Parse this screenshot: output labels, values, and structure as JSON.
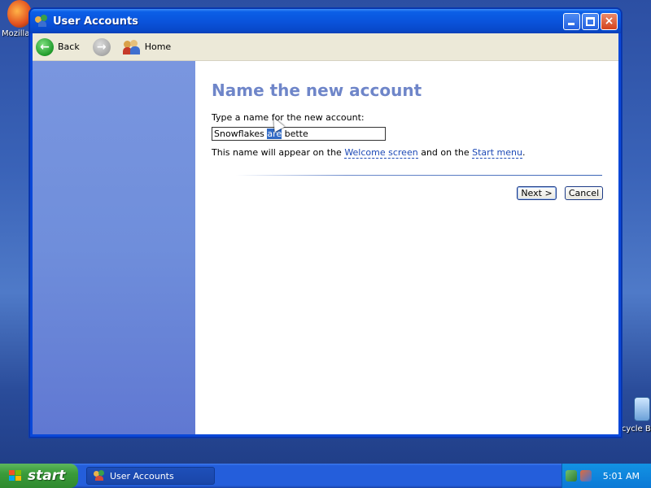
{
  "desktop": {
    "icons": [
      {
        "label": "Mozilla"
      },
      {
        "label": "Recycle Bin"
      }
    ]
  },
  "window": {
    "title": "User Accounts",
    "controls": {
      "minimize": "minimize",
      "maximize": "maximize",
      "close": "×"
    }
  },
  "toolbar": {
    "back_label": "Back",
    "home_label": "Home"
  },
  "main": {
    "heading": "Name the new account",
    "field_label": "Type a name for the new account:",
    "input_value_before": "Snowflakes ",
    "input_value_selected": "are",
    "input_value_after": " bette",
    "info_prefix": "This name will appear on the ",
    "info_link1": "Welcome screen",
    "info_middle": " and on the ",
    "info_link2": "Start menu",
    "info_suffix": ".",
    "next_label": "Next >",
    "cancel_label": "Cancel"
  },
  "taskbar": {
    "start_label": "start",
    "task_item": "User Accounts",
    "clock": "5:01 AM"
  },
  "colors": {
    "heading": "#6f86c9",
    "left_pane": "#7a96df",
    "selection": "#316ac5",
    "titlebar": "#0a54dc"
  }
}
